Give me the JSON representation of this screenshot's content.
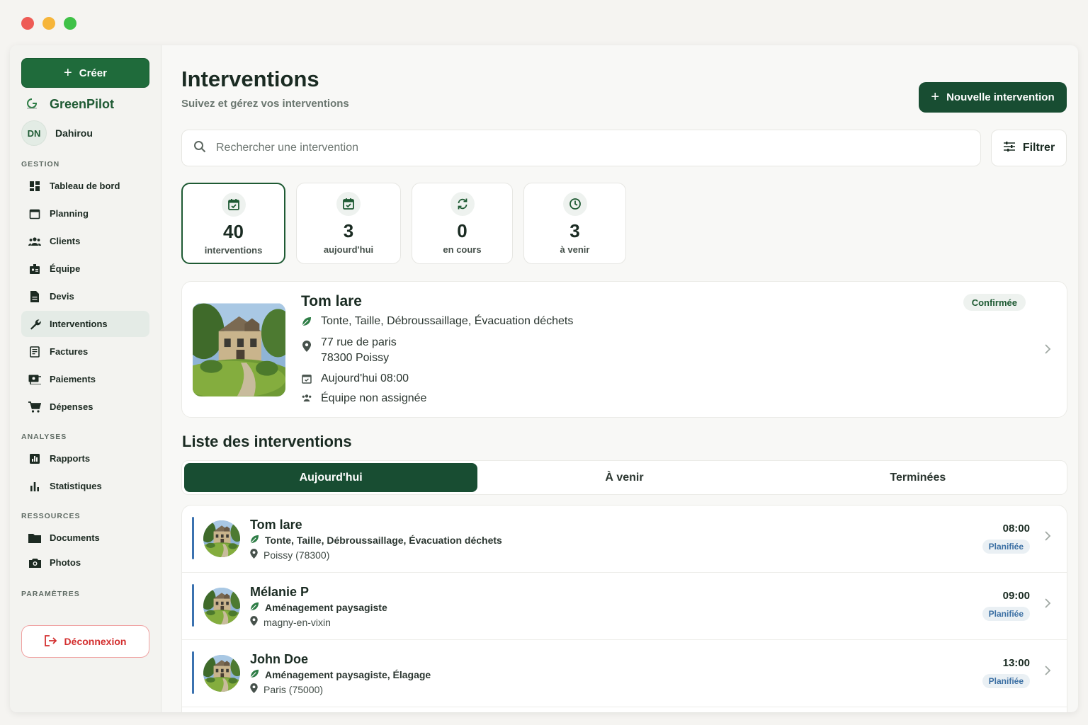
{
  "colors": {
    "brand": "#1f6b3b",
    "brand_dark": "#184d32",
    "danger": "#d32f2f",
    "planned": "#3b6fa3"
  },
  "sidebar": {
    "create_label": "Créer",
    "brand_name": "GreenPilot",
    "user": {
      "initials": "DN",
      "name": "Dahirou"
    },
    "sections": {
      "gestion": "GESTION",
      "analyses": "ANALYSES",
      "ressources": "RESSOURCES",
      "parametres": "PARAMÈTRES"
    },
    "items": {
      "dashboard": "Tableau de bord",
      "planning": "Planning",
      "clients": "Clients",
      "equipe": "Équipe",
      "devis": "Devis",
      "interventions": "Interventions",
      "factures": "Factures",
      "paiements": "Paiements",
      "depenses": "Dépenses",
      "rapports": "Rapports",
      "statistiques": "Statistiques",
      "documents": "Documents",
      "photos": "Photos"
    },
    "logout_label": "Déconnexion"
  },
  "header": {
    "title": "Interventions",
    "subtitle": "Suivez et gérez vos interventions",
    "new_button": "Nouvelle intervention"
  },
  "search": {
    "placeholder": "Rechercher une intervention",
    "filter_label": "Filtrer"
  },
  "stats": [
    {
      "value": "40",
      "label": "interventions",
      "icon": "calendar-check-icon"
    },
    {
      "value": "3",
      "label": "aujourd'hui",
      "icon": "calendar-check-icon"
    },
    {
      "value": "0",
      "label": "en cours",
      "icon": "sync-icon"
    },
    {
      "value": "3",
      "label": "à venir",
      "icon": "clock-icon"
    }
  ],
  "featured": {
    "name": "Tom lare",
    "status": "Confirmée",
    "services": "Tonte, Taille, Débroussaillage, Évacuation déchets",
    "address_line1": "77 rue de paris",
    "address_line2": "78300 Poissy",
    "datetime": "Aujourd'hui 08:00",
    "team": "Équipe non assignée"
  },
  "list": {
    "title": "Liste des interventions",
    "tabs": [
      "Aujourd'hui",
      "À venir",
      "Terminées"
    ],
    "rows": [
      {
        "name": "Tom lare",
        "services": "Tonte, Taille, Débroussaillage, Évacuation déchets",
        "location": "Poissy (78300)",
        "time": "08:00",
        "status": "Planifiée"
      },
      {
        "name": "Mélanie P",
        "services": "Aménagement paysagiste",
        "location": "magny-en-vixin",
        "time": "09:00",
        "status": "Planifiée"
      },
      {
        "name": "John Doe",
        "services": "Aménagement paysagiste, Élagage",
        "location": "Paris (75000)",
        "time": "13:00",
        "status": "Planifiée"
      }
    ]
  }
}
